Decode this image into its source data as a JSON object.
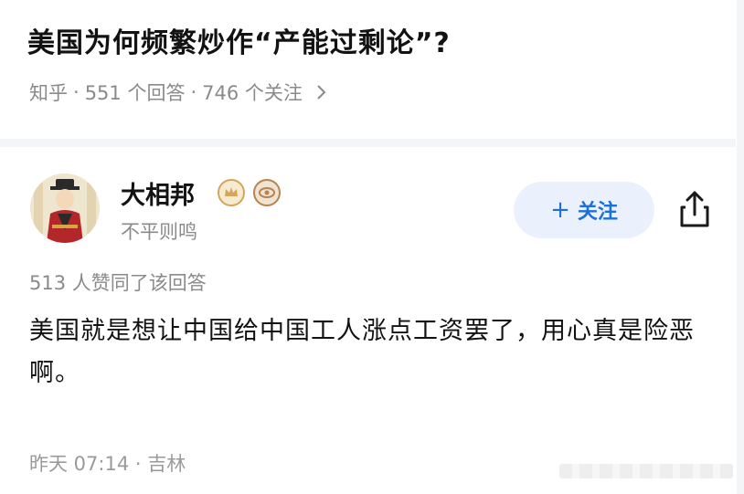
{
  "question": {
    "title": "美国为何频繁炒作“产能过剩论”?",
    "source": "知乎",
    "answers": "551 个回答",
    "followers": "746 个关注",
    "separator": "·"
  },
  "author": {
    "name": "大相邦",
    "bio": "不平则鸣"
  },
  "follow_button": {
    "plus": "+",
    "label": "关注"
  },
  "answer": {
    "votes": "513 人赞同了该回答",
    "text": "美国就是想让中国给中国工人涨点工资罢了，用心真是险恶啊。",
    "time": "昨天 07:14",
    "location": "吉林",
    "separator": "·"
  },
  "colors": {
    "accent": "#1e6fd9",
    "follow_bg": "#eaf1fc",
    "meta_text": "#8a8a8a"
  },
  "icons": [
    "chevron-right-icon",
    "crown-badge-icon",
    "eye-badge-icon",
    "share-icon"
  ]
}
